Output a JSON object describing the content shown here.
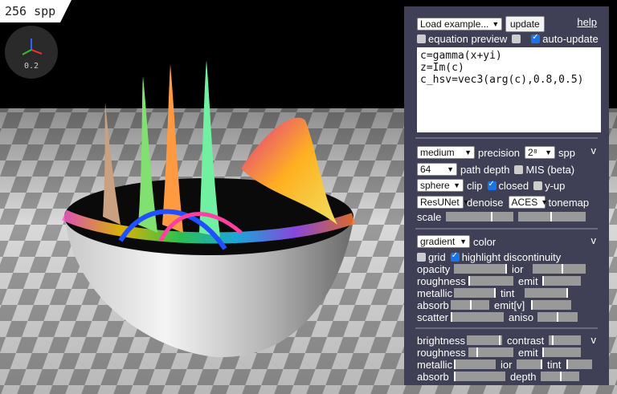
{
  "render": {
    "spp": "256 spp",
    "gizmo_value": "0.2"
  },
  "panel": {
    "load_example": "Load example...",
    "update": "update",
    "help": "help",
    "equation_preview": "equation preview",
    "auto_update": "auto-update",
    "code": [
      "c=gamma(x+yi)",
      "z=Im(c)",
      "c_hsv=vec3(arg(c),0.8,0.5)"
    ]
  },
  "render_settings": {
    "precision_value": "medium",
    "precision_label": "precision",
    "spp_value": "2⁸",
    "spp_label": "spp",
    "path_depth_value": "64",
    "path_depth_label": "path depth",
    "mis_label": "MIS (beta)",
    "clip_value": "sphere",
    "clip_label": "clip",
    "closed_label": "closed",
    "yup_label": "y-up",
    "denoise_value": "ResUNet",
    "denoise_label": "denoise",
    "tonemap_value": "ACES",
    "tonemap_label": "tonemap",
    "scale_label": "scale",
    "collapse": "v"
  },
  "material": {
    "color_value": "gradient",
    "color_label": "color",
    "grid_label": "grid",
    "highlight_label": "highlight discontinuity",
    "opacity": "opacity",
    "ior": "ior",
    "roughness": "roughness",
    "emit": "emit",
    "metallic": "metallic",
    "tint": "tint",
    "absorb": "absorb",
    "emit_v": "emit[v]",
    "scatter": "scatter",
    "aniso": "aniso",
    "collapse": "v"
  },
  "lighting": {
    "brightness": "brightness",
    "contrast": "contrast",
    "roughness": "roughness",
    "emit": "emit",
    "metallic": "metallic",
    "ior": "ior",
    "tint": "tint",
    "absorb": "absorb",
    "depth": "depth",
    "collapse": "v"
  }
}
